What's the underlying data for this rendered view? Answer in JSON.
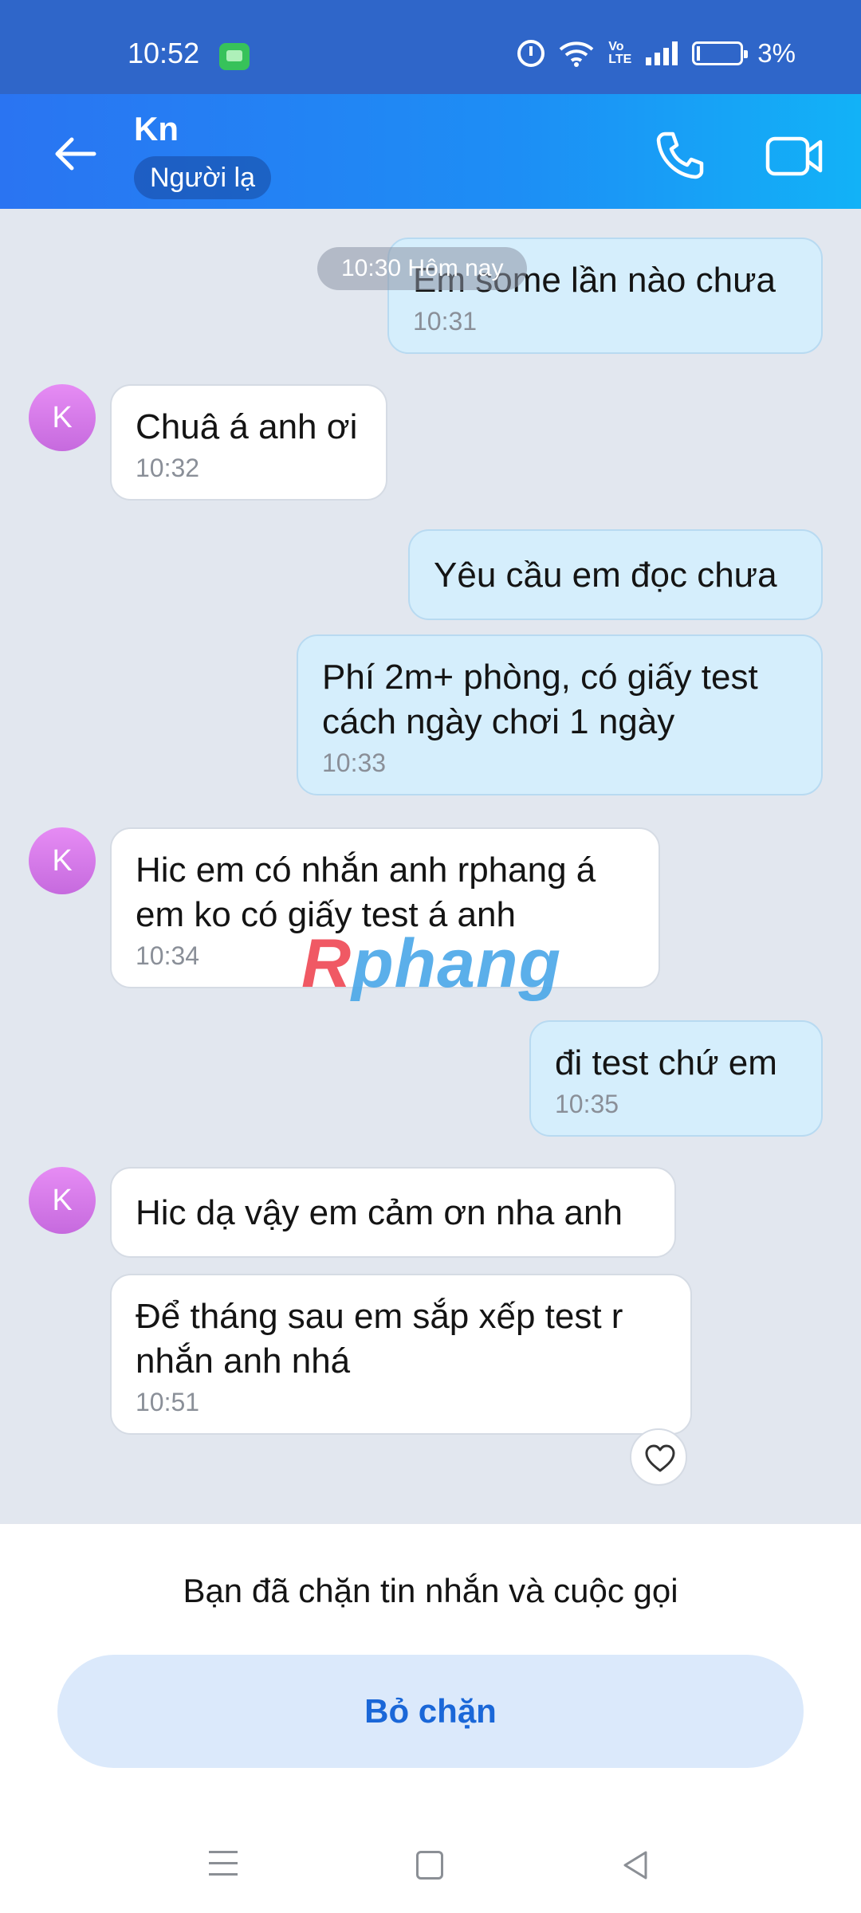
{
  "status_bar": {
    "time": "10:52",
    "volte": "Vo\nLTE",
    "battery": "3%"
  },
  "header": {
    "name": "Kn",
    "badge": "Người lạ"
  },
  "chat": {
    "date_label": "10:30 Hôm nay",
    "avatar_letter": "K",
    "messages": [
      {
        "dir": "out",
        "text": "Em some lần nào chưa",
        "time": "10:31"
      },
      {
        "dir": "in",
        "text": "Chuâ á anh ơi",
        "time": "10:32"
      },
      {
        "dir": "out",
        "text": "Yêu cầu em đọc chưa",
        "time": ""
      },
      {
        "dir": "out",
        "text": "Phí 2m+ phòng, có giấy test cách ngày chơi 1 ngày",
        "time": "10:33"
      },
      {
        "dir": "in",
        "text": "Hic em có nhắn anh rphang á em ko có giấy test á anh",
        "time": "10:34"
      },
      {
        "dir": "out",
        "text": "đi test chứ em",
        "time": "10:35"
      },
      {
        "dir": "in",
        "text": "Hic dạ vậy em cảm ơn nha anh",
        "time": ""
      },
      {
        "dir": "in",
        "text": "Để tháng sau em sắp xếp test r nhắn anh nhá",
        "time": "10:51"
      }
    ],
    "watermark": "Rphang"
  },
  "footer": {
    "blocked_text": "Bạn đã chặn tin nhắn và cuộc gọi",
    "unblock_label": "Bỏ chặn"
  },
  "colors": {
    "header_start": "#2a74f2",
    "header_end": "#12b2f7",
    "accent": "#1a67d8",
    "outgoing_bubble": "#d5eefc"
  }
}
